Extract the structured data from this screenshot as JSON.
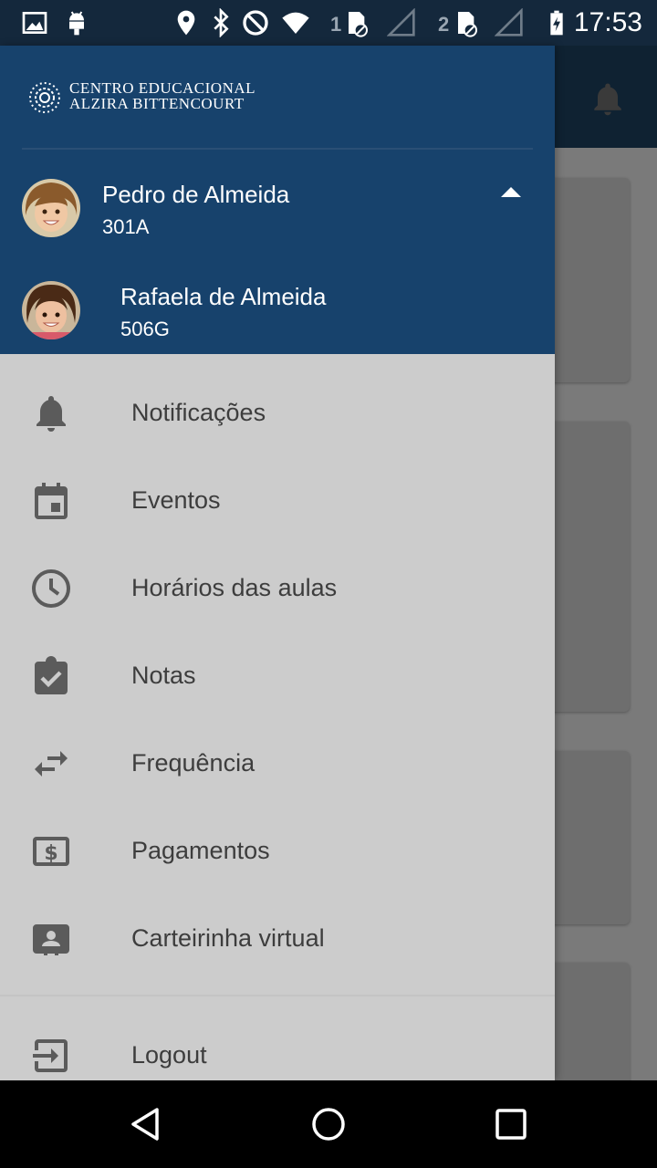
{
  "status_bar": {
    "time": "17:53",
    "sim1_number": "1",
    "sim2_number": "2",
    "icons": [
      "image-icon",
      "android-icon",
      "location-icon",
      "bluetooth-icon",
      "do-not-disturb-icon",
      "wifi-icon",
      "sim-card-icon",
      "signal-icon",
      "battery-charging-icon"
    ]
  },
  "drawer": {
    "logo": {
      "line1": "CENTRO EDUCACIONAL",
      "line2": "ALZIRA BITTENCOURT"
    },
    "accounts": [
      {
        "name": "Pedro de Almeida",
        "class": "301A",
        "active": true
      },
      {
        "name": "Rafaela de Almeida",
        "class": "506G",
        "active": false
      }
    ],
    "menu": [
      {
        "label": "Notificações",
        "icon": "bell-icon"
      },
      {
        "label": "Eventos",
        "icon": "calendar-icon"
      },
      {
        "label": "Horários das aulas",
        "icon": "clock-icon"
      },
      {
        "label": "Notas",
        "icon": "clipboard-check-icon"
      },
      {
        "label": "Frequência",
        "icon": "swap-arrows-icon"
      },
      {
        "label": "Pagamentos",
        "icon": "dollar-card-icon"
      },
      {
        "label": "Carteirinha virtual",
        "icon": "id-card-icon"
      }
    ],
    "logout_label": "Logout"
  },
  "colors": {
    "header": "#17426c",
    "drawer_bg": "#cccccc",
    "status_bar": "#14283c",
    "icon": "#5b5b5b"
  }
}
